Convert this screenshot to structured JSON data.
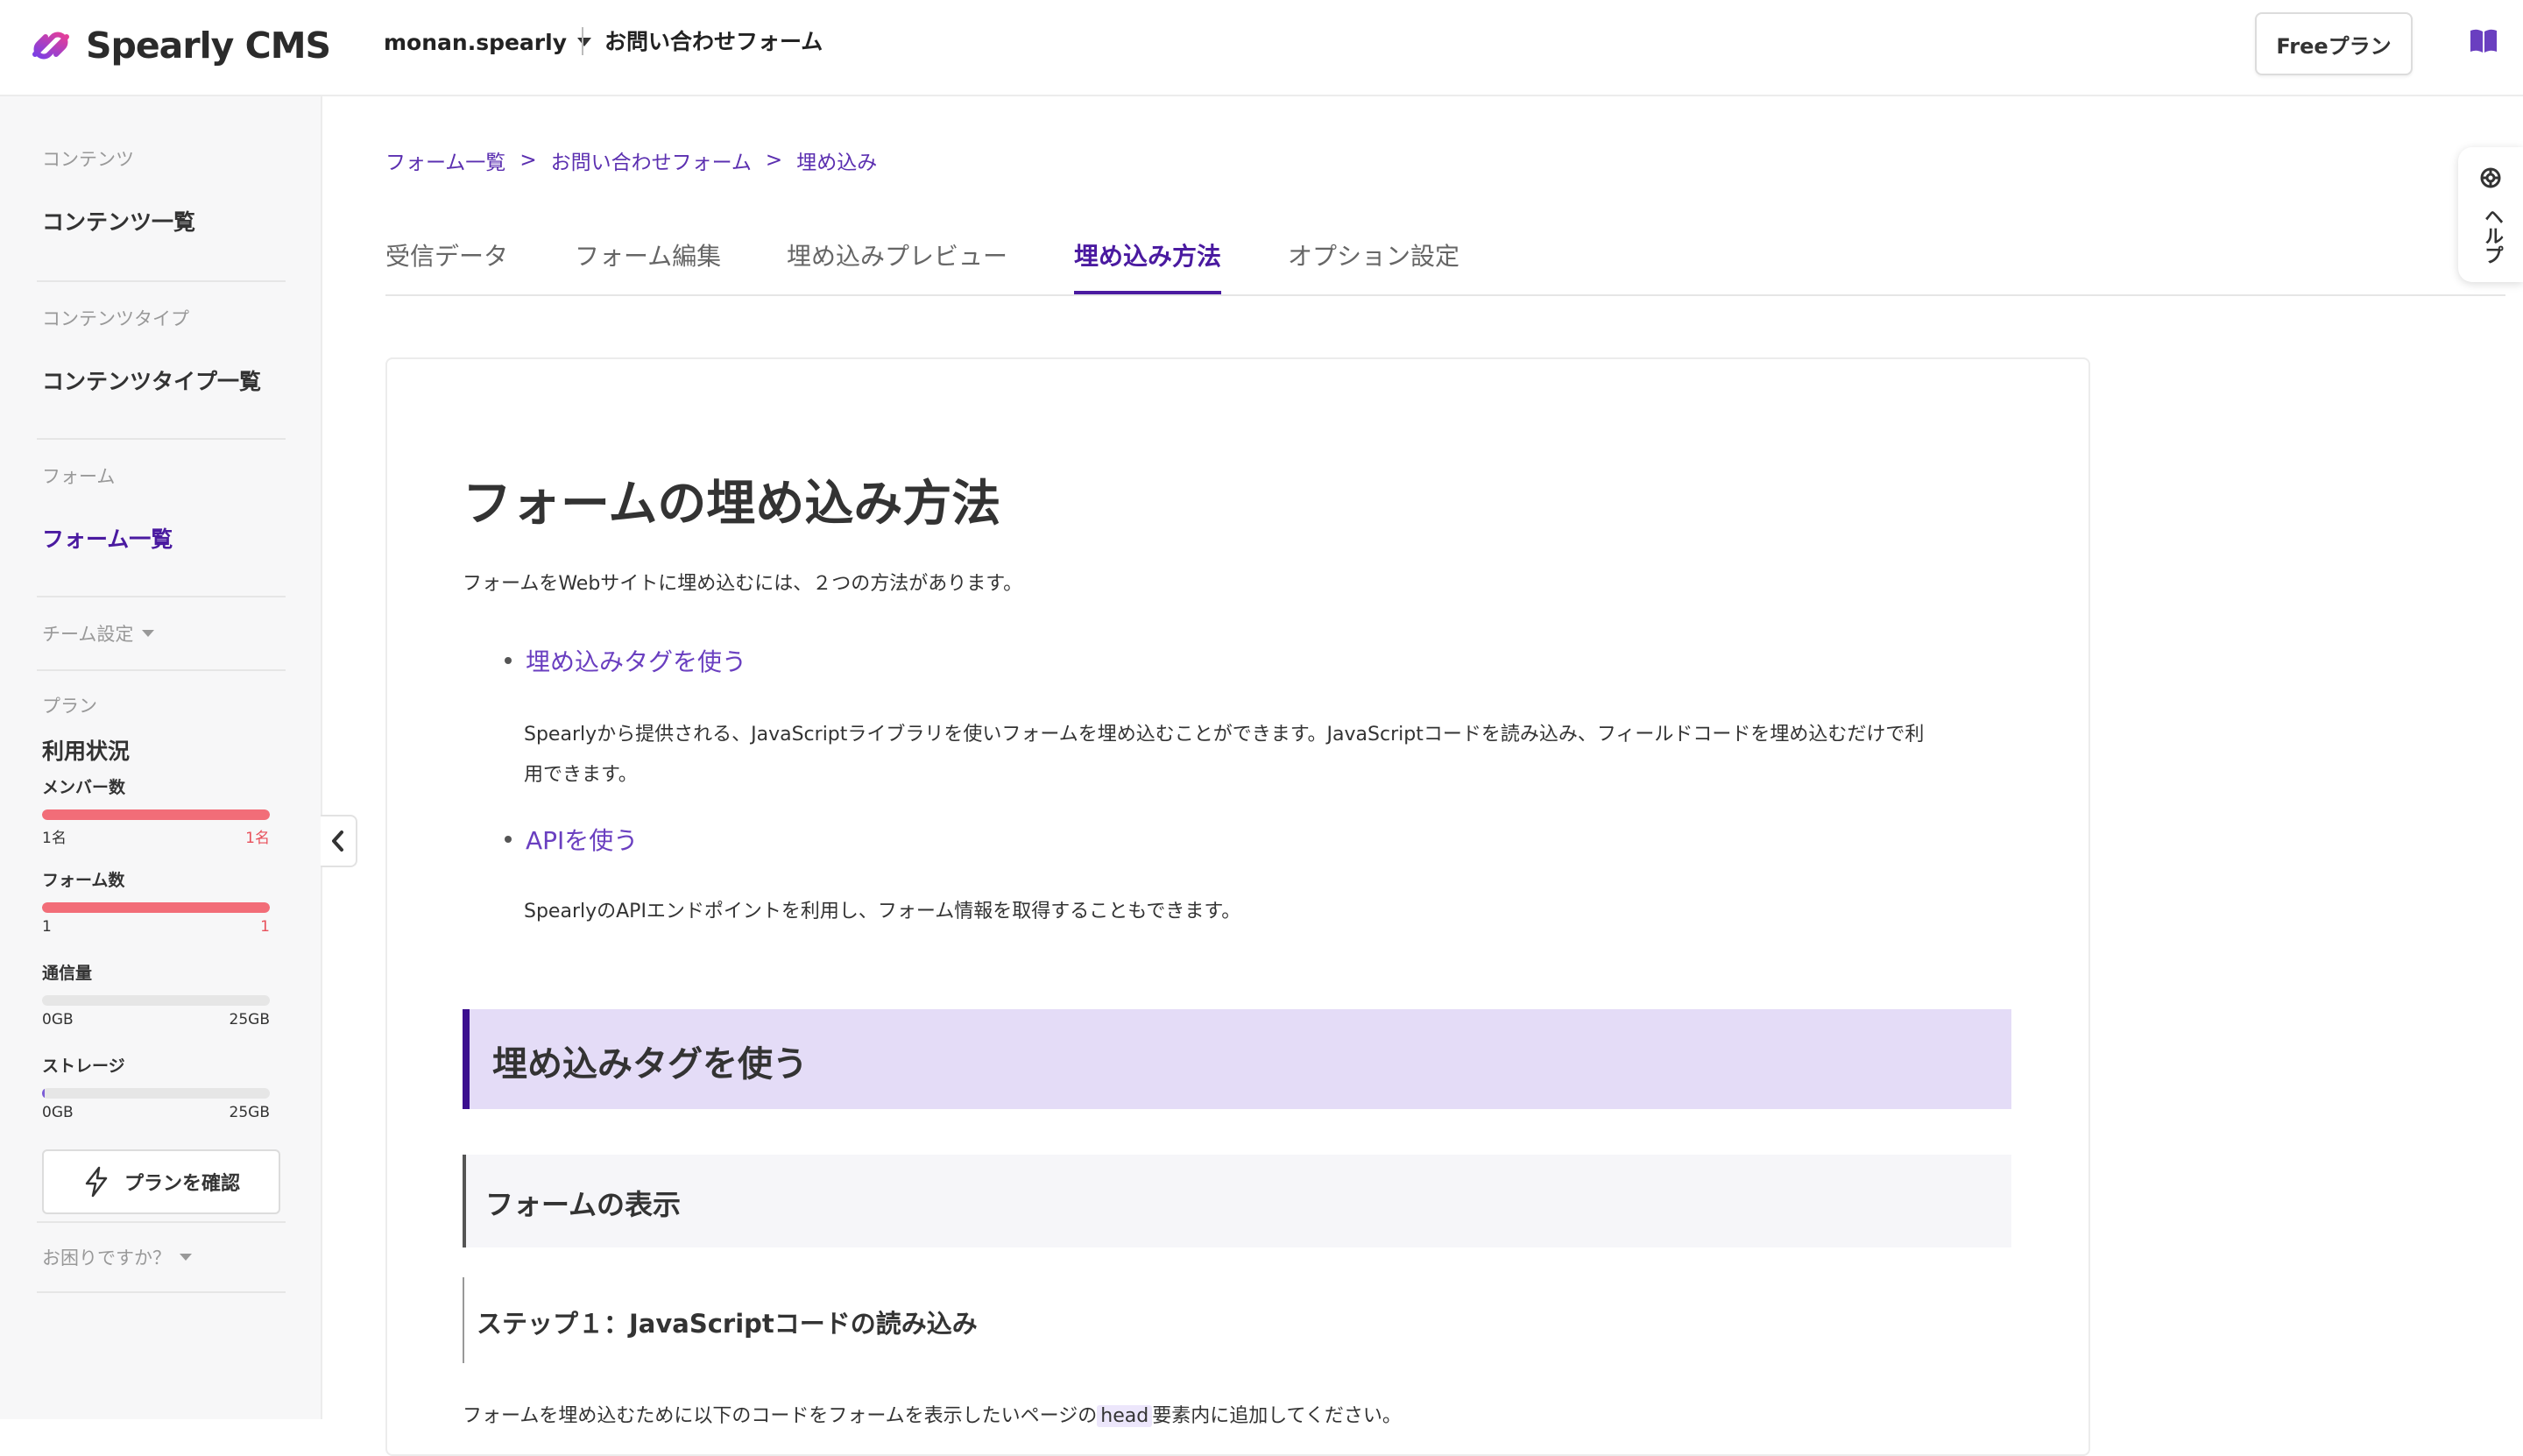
{
  "app": {
    "logo_text": "Spearly CMS",
    "team_name": "monan.spearly",
    "form_name": "お問い合わせフォーム",
    "plan_button": "Freeプラン"
  },
  "sidebar": {
    "section_content": "コンテンツ",
    "item_content_list": "コンテンツ一覧",
    "section_content_type": "コンテンツタイプ",
    "item_content_type_list": "コンテンツタイプ一覧",
    "section_form": "フォーム",
    "item_form_list": "フォーム一覧",
    "team_settings": "チーム設定",
    "section_plan": "プラン",
    "usage_title": "利用状況",
    "usage": [
      {
        "label": "メンバー数",
        "min": "1名",
        "max": "1名",
        "fraction": 1.0,
        "color": "#f26d78",
        "max_color": "#e8505b"
      },
      {
        "label": "フォーム数",
        "min": "1",
        "max": "1",
        "fraction": 1.0,
        "color": "#f26d78",
        "max_color": "#e8505b"
      },
      {
        "label": "通信量",
        "min": "0GB",
        "max": "25GB",
        "fraction": 0.0,
        "color": "#7b5cd6",
        "max_color": "#333333"
      },
      {
        "label": "ストレージ",
        "min": "0GB",
        "max": "25GB",
        "fraction": 0.005,
        "color": "#7b5cd6",
        "max_color": "#333333"
      }
    ],
    "confirm_plan": "プランを確認",
    "trouble": "お困りですか？"
  },
  "breadcrumb": [
    "フォーム一覧",
    "お問い合わせフォーム",
    "埋め込み"
  ],
  "breadcrumb_sep": ">",
  "tabs": [
    {
      "label": "受信データ",
      "active": false
    },
    {
      "label": "フォーム編集",
      "active": false
    },
    {
      "label": "埋め込みプレビュー",
      "active": false
    },
    {
      "label": "埋め込み方法",
      "active": true
    },
    {
      "label": "オプション設定",
      "active": false
    }
  ],
  "help_label": "ヘルプ",
  "doc": {
    "title": "フォームの埋め込み方法",
    "intro": "フォームをWebサイトに埋め込むには、２つの方法があります。",
    "method1_link": "埋め込みタグを使う",
    "method1_desc_line1": "Spearlyから提供される、JavaScriptライブラリを使いフォームを埋め込むことができます。JavaScriptコードを読み込み、フィールドコードを埋め込むだけで利",
    "method1_desc_line2": "用できます。",
    "method2_link": "APIを使う",
    "method2_desc": "SpearlyのAPIエンドポイントを利用し、フォーム情報を取得することもできます。",
    "h2": "埋め込みタグを使う",
    "h3": "フォームの表示",
    "h4": "ステップ１：JavaScriptコードの読み込み",
    "step1_text_pre": "フォームを埋め込むために以下のコードをフォームを表示したいページの",
    "step1_code": "head",
    "step1_text_post": "要素内に追加してください。"
  },
  "colors": {
    "accent": "#4a1aa0",
    "link": "#6a3fc0",
    "h2_bg": "#e4dcf7"
  }
}
